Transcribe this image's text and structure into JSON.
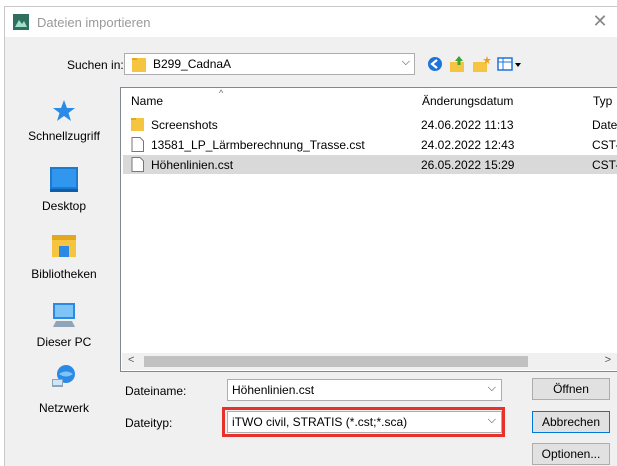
{
  "window": {
    "title": "Dateien importieren"
  },
  "lookin": {
    "label": "Suchen in:",
    "value": "B299_CadnaA"
  },
  "places": [
    {
      "label": "Schnellzugriff",
      "icon": "star-icon"
    },
    {
      "label": "Desktop",
      "icon": "desktop-icon"
    },
    {
      "label": "Bibliotheken",
      "icon": "library-icon"
    },
    {
      "label": "Dieser PC",
      "icon": "computer-icon"
    },
    {
      "label": "Netzwerk",
      "icon": "network-icon"
    }
  ],
  "columns": {
    "name": "Name",
    "date": "Änderungsdatum",
    "type": "Typ"
  },
  "files": [
    {
      "name": "Screenshots",
      "date": "24.06.2022 11:13",
      "type": "Datei",
      "kind": "folder"
    },
    {
      "name": "13581_LP_Lärmberechnung_Trasse.cst",
      "date": "24.02.2022 12:43",
      "type": "CST-D",
      "kind": "file"
    },
    {
      "name": "Höhenlinien.cst",
      "date": "26.05.2022 15:29",
      "type": "CST-D",
      "kind": "file",
      "selected": true
    }
  ],
  "filename": {
    "label": "Dateiname:",
    "value": "Höhenlinien.cst"
  },
  "filetype": {
    "label": "Dateityp:",
    "value": "iTWO civil, STRATIS (*.cst;*.sca)"
  },
  "buttons": {
    "open": "Öffnen",
    "cancel": "Abbrechen",
    "options": "Optionen..."
  },
  "colors": {
    "highlight": "#e8312a",
    "selection": "#d9d9d9",
    "folder": "#f5c542"
  }
}
